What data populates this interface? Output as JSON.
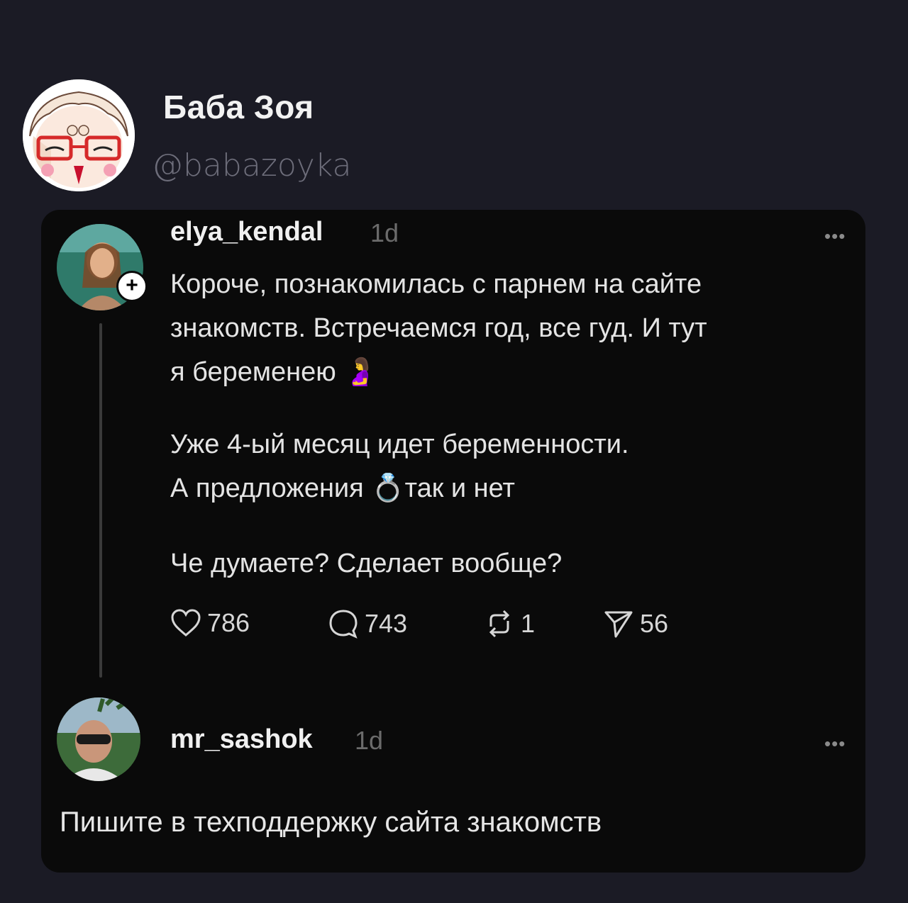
{
  "profile": {
    "name": "Баба Зоя",
    "handle": "@babazoyka"
  },
  "post": {
    "username": "elya_kendal",
    "time": "1d",
    "more": "•••",
    "follow_badge": "+",
    "paragraphs": [
      "Короче, познакомилась с парнем на сайте\nзнакомств. Встречаемся год, все гуд. И тут\nя беременею 🤰",
      "Уже 4-ый месяц идет беременности.\nА предложения 💍так и нет",
      "Че думаете? Сделает вообще?"
    ],
    "actions": [
      {
        "icon": "heart-icon",
        "count": "786"
      },
      {
        "icon": "comment-icon",
        "count": "743"
      },
      {
        "icon": "repost-icon",
        "count": "1"
      },
      {
        "icon": "share-icon",
        "count": "56"
      }
    ]
  },
  "reply": {
    "username": "mr_sashok",
    "time": "1d",
    "more": "•••",
    "text": "Пишите в техподдержку сайта знакомств"
  }
}
